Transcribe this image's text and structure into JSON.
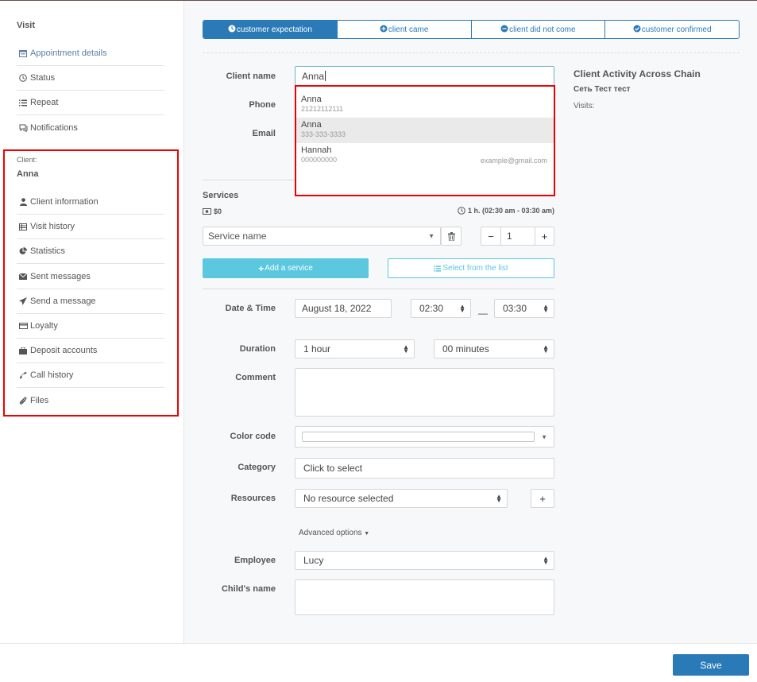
{
  "sidebar": {
    "title": "Visit",
    "visit_items": [
      {
        "label": "Appointment details",
        "icon": "calendar-icon"
      },
      {
        "label": "Status",
        "icon": "clock-icon"
      },
      {
        "label": "Repeat",
        "icon": "list-icon"
      },
      {
        "label": "Notifications",
        "icon": "chat-icon"
      }
    ],
    "client_label": "Client:",
    "client_name": "Anna",
    "client_items": [
      {
        "label": "Client information",
        "icon": "user-icon"
      },
      {
        "label": "Visit history",
        "icon": "table-icon"
      },
      {
        "label": "Statistics",
        "icon": "pie-chart-icon"
      },
      {
        "label": "Sent messages",
        "icon": "envelope-icon"
      },
      {
        "label": "Send a message",
        "icon": "paper-plane-icon"
      },
      {
        "label": "Loyalty",
        "icon": "credit-card-icon"
      },
      {
        "label": "Deposit accounts",
        "icon": "briefcase-icon"
      },
      {
        "label": "Call history",
        "icon": "phone-icon"
      },
      {
        "label": "Files",
        "icon": "paperclip-icon"
      }
    ]
  },
  "status_tabs": [
    {
      "label": "customer expectation",
      "icon": "clock-icon",
      "active": true
    },
    {
      "label": "client came",
      "icon": "plus-circle-icon",
      "active": false
    },
    {
      "label": "client did not come",
      "icon": "minus-circle-icon",
      "active": false
    },
    {
      "label": "customer confirmed",
      "icon": "check-circle-icon",
      "active": false
    }
  ],
  "form": {
    "client_name_label": "Client name",
    "client_name_value": "Anna",
    "phone_label": "Phone",
    "email_label": "Email",
    "services_label": "Services",
    "price": "$0",
    "duration_info": "1 h. (02:30 am - 03:30 am)",
    "service_placeholder": "Service name",
    "quantity": "1",
    "add_service": "Add a service",
    "select_list": "Select from the list",
    "datetime_label": "Date & Time",
    "date_value": "August 18, 2022",
    "time_start": "02:30",
    "time_end": "03:30",
    "time_separator": "—",
    "duration_label": "Duration",
    "duration_hours": "1 hour",
    "duration_minutes": "00 minutes",
    "comment_label": "Comment",
    "color_label": "Color code",
    "category_label": "Category",
    "category_value": "Click to select",
    "resources_label": "Resources",
    "resources_value": "No resource selected",
    "advanced": "Advanced options",
    "employee_label": "Employee",
    "employee_value": "Lucy",
    "child_label": "Child's name"
  },
  "suggestions": [
    {
      "name": "Anna",
      "phone": "21212112111",
      "email": ""
    },
    {
      "name": "Anna",
      "phone": "333-333-3333",
      "email": "",
      "highlighted": true
    },
    {
      "name": "Hannah",
      "phone": "000000000",
      "email": "example@gmail.com"
    }
  ],
  "activity": {
    "title": "Client Activity Across Chain",
    "network": "Сеть Тест тест",
    "visits": "Visits:"
  },
  "footer": {
    "save": "Save"
  },
  "colors": {
    "primary": "#2a7ab8",
    "accent": "#5bc8e0",
    "highlight_border": "#e00000"
  }
}
